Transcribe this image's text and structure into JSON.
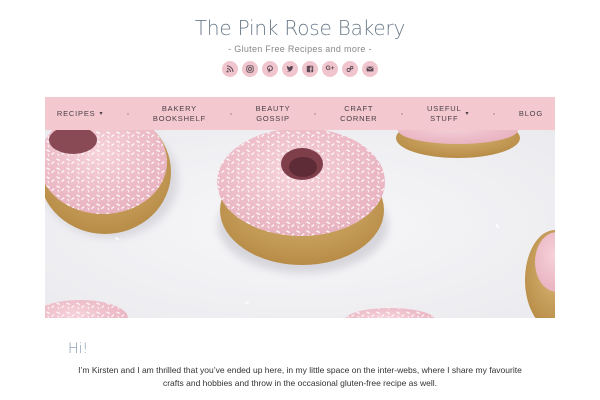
{
  "header": {
    "site_title": "The Pink Rose Bakery",
    "tagline": "- Gluten Free Recipes and more -"
  },
  "social_icons": [
    "rss-icon",
    "instagram-icon",
    "pinterest-icon",
    "twitter-icon",
    "facebook-icon",
    "google-plus-icon",
    "bloglovin-icon",
    "email-icon"
  ],
  "nav": {
    "items": [
      {
        "label": "RECIPES",
        "has_dropdown": true
      },
      {
        "label": "BAKERY BOOKSHELF",
        "line1": "BAKERY",
        "line2": "BOOKSHELF"
      },
      {
        "label": "BEAUTY GOSSIP",
        "line1": "BEAUTY",
        "line2": "GOSSIP"
      },
      {
        "label": "CRAFT CORNER",
        "line1": "CRAFT",
        "line2": "CORNER"
      },
      {
        "label": "USEFUL STUFF",
        "line1": "USEFUL",
        "line2": "STUFF",
        "has_dropdown": true
      },
      {
        "label": "BLOG"
      }
    ]
  },
  "main": {
    "greeting": "Hi!",
    "intro": "I’m Kirsten and I am thrilled that you’ve ended up here, in my little space on the inter-webs, where I share my favourite crafts and hobbies and throw in the occasional gluten-free recipe as well."
  },
  "colors": {
    "nav_bg": "#f3c8cf",
    "icon_bg": "#f1c5cd",
    "title": "#6e7d8c",
    "greeting": "#7f93ad"
  }
}
